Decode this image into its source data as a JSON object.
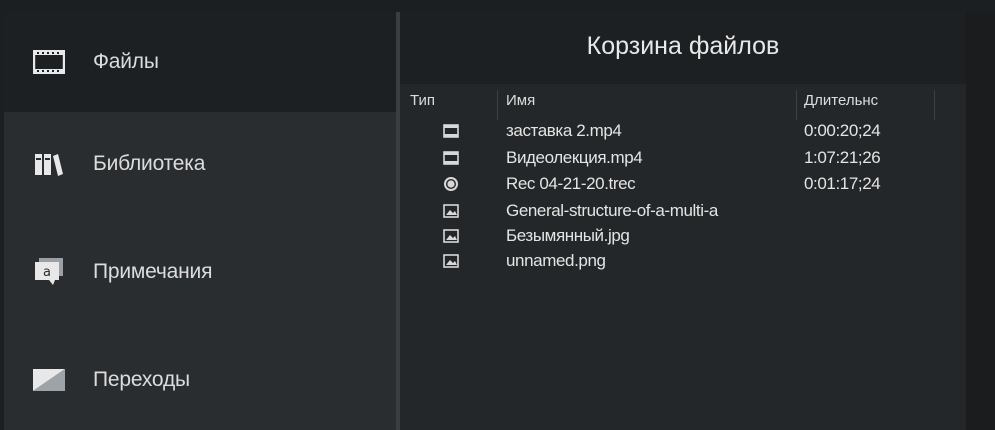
{
  "sidebar": {
    "items": [
      {
        "label": "Файлы",
        "icon": "film-icon",
        "active": true
      },
      {
        "label": "Библиотека",
        "icon": "library-books-icon",
        "active": false
      },
      {
        "label": "Примечания",
        "icon": "annotation-callout-icon",
        "active": false
      },
      {
        "label": "Переходы",
        "icon": "transition-icon",
        "active": false
      }
    ]
  },
  "panel": {
    "title": "Корзина файлов",
    "columns": {
      "type": "Тип",
      "name": "Имя",
      "duration": "Длительнс"
    },
    "rows": [
      {
        "icon": "video-file-icon",
        "name": "заставка 2.mp4",
        "duration": "0:00:20;24"
      },
      {
        "icon": "video-file-icon",
        "name": "Видеолекция.mp4",
        "duration": "1:07:21;26"
      },
      {
        "icon": "recording-file-icon",
        "name": "Rec 04-21-20.trec",
        "duration": "0:01:17;24"
      },
      {
        "icon": "image-file-icon",
        "name": "General-structure-of-a-multi-a",
        "duration": ""
      },
      {
        "icon": "image-file-icon",
        "name": "Безымянный.jpg",
        "duration": ""
      },
      {
        "icon": "image-file-icon",
        "name": "unnamed.png",
        "duration": ""
      }
    ]
  },
  "colors": {
    "sidebar_bg": "#2a2d30",
    "sidebar_active_bg": "#1d2023",
    "content_bg": "#242729",
    "title_bar_bg": "#1d2022",
    "text": "#e4e4e4"
  }
}
